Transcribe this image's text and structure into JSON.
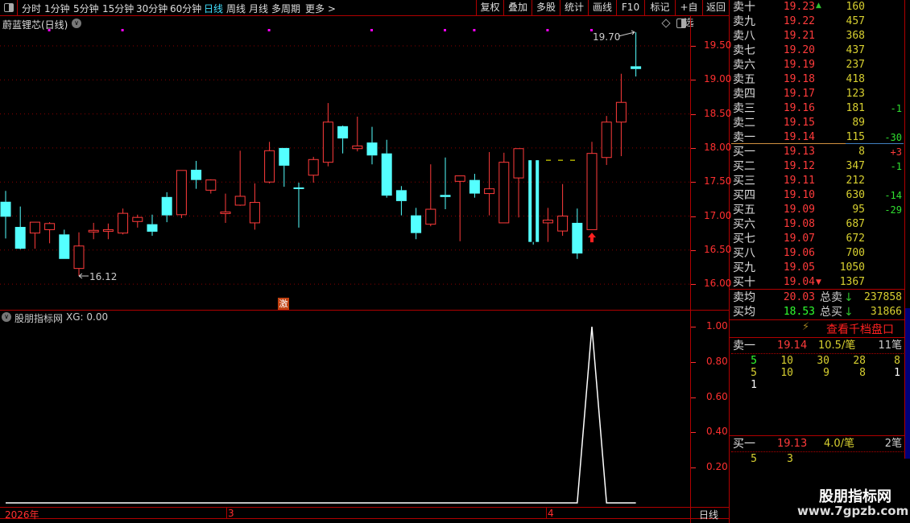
{
  "toolbar": {
    "periods": [
      "分时",
      "1分钟",
      "5分钟",
      "15分钟",
      "30分钟",
      "60分钟",
      "日线",
      "周线",
      "月线",
      "多周期",
      "更多 >"
    ],
    "active": "日线",
    "buttons": [
      "复权",
      "叠加",
      "多股",
      "统计",
      "画线",
      "F10",
      "标记",
      "+自选",
      "返回"
    ]
  },
  "chart": {
    "title": "蔚蓝锂芯(日线)",
    "high_label": "19.70",
    "low_label": "16.12",
    "signal_badge": "激",
    "price_ticks": [
      "19.50",
      "19.00",
      "18.50",
      "18.00",
      "17.50",
      "17.00",
      "16.50",
      "16.00"
    ]
  },
  "indicator": {
    "title": "股朋指标网",
    "value": "XG: 0.00",
    "ticks": [
      "1.00",
      "0.80",
      "0.60",
      "0.40",
      "0.20"
    ]
  },
  "time_axis": {
    "labels": [
      "2026年",
      "3",
      "4"
    ],
    "period": "日线"
  },
  "chart_data": {
    "type": "candlestick",
    "price_range": [
      15.9,
      19.8
    ],
    "candles": [
      [
        17.21,
        17.37,
        16.67,
        16.99
      ],
      [
        16.84,
        17.14,
        16.51,
        16.52
      ],
      [
        16.75,
        16.91,
        16.52,
        16.91
      ],
      [
        16.8,
        16.91,
        16.6,
        16.89
      ],
      [
        16.73,
        16.8,
        16.37,
        16.37
      ],
      [
        16.23,
        16.76,
        16.12,
        16.56
      ],
      [
        16.79,
        16.9,
        16.66,
        16.79
      ],
      [
        16.78,
        16.89,
        16.66,
        16.8
      ],
      [
        16.75,
        17.11,
        16.73,
        17.04
      ],
      [
        16.92,
        17.02,
        16.83,
        16.98
      ],
      [
        16.88,
        17.02,
        16.71,
        16.77
      ],
      [
        17.28,
        17.35,
        16.91,
        17.01
      ],
      [
        17.02,
        17.67,
        16.97,
        17.67
      ],
      [
        17.68,
        17.81,
        17.4,
        17.53
      ],
      [
        17.38,
        17.54,
        17.33,
        17.53
      ],
      [
        17.04,
        17.33,
        16.9,
        17.06
      ],
      [
        17.16,
        17.96,
        17.15,
        17.29
      ],
      [
        16.9,
        17.48,
        16.8,
        17.2
      ],
      [
        17.5,
        18.09,
        17.48,
        17.96
      ],
      [
        18.0,
        18.0,
        17.43,
        17.74
      ],
      [
        17.42,
        17.49,
        16.83,
        17.4
      ],
      [
        17.6,
        17.87,
        17.49,
        17.83
      ],
      [
        17.79,
        18.66,
        17.73,
        18.38
      ],
      [
        18.32,
        18.33,
        17.92,
        18.14
      ],
      [
        17.99,
        18.46,
        17.95,
        18.03
      ],
      [
        18.08,
        18.31,
        17.76,
        17.89
      ],
      [
        17.92,
        18.12,
        17.27,
        17.3
      ],
      [
        17.38,
        17.44,
        17.01,
        17.22
      ],
      [
        17.01,
        17.12,
        16.66,
        16.75
      ],
      [
        16.88,
        17.76,
        16.85,
        17.1
      ],
      [
        17.31,
        17.86,
        17.1,
        17.28
      ],
      [
        17.51,
        17.59,
        16.63,
        17.59
      ],
      [
        17.53,
        17.62,
        17.27,
        17.33
      ],
      [
        17.33,
        17.94,
        17.01,
        17.4
      ],
      [
        16.9,
        17.93,
        16.9,
        17.79
      ],
      [
        17.56,
        17.99,
        16.98,
        17.99
      ],
      [
        17.82,
        17.82,
        16.58,
        16.62
      ],
      [
        16.9,
        17.12,
        16.62,
        16.94
      ],
      [
        16.78,
        17.47,
        16.71,
        17.0
      ],
      [
        16.9,
        17.11,
        16.37,
        16.45
      ],
      [
        16.8,
        18.09,
        16.8,
        17.92
      ],
      [
        17.86,
        18.47,
        17.75,
        18.38
      ],
      [
        18.38,
        19.09,
        17.88,
        18.67
      ],
      [
        19.2,
        19.7,
        19.05,
        19.16
      ]
    ],
    "signal_dots": [
      3,
      8,
      18,
      25,
      30,
      32,
      37,
      40
    ],
    "dashed_level": 17.82,
    "arrow_index": 40,
    "indicator_values": [
      0,
      0,
      0,
      0,
      0,
      0,
      0,
      0,
      0,
      0,
      0,
      0,
      0,
      0,
      0,
      0,
      0,
      0,
      0,
      0,
      0,
      0,
      0,
      0,
      0,
      0,
      0,
      0,
      0,
      0,
      0,
      0,
      0,
      0,
      0,
      0,
      0,
      0,
      0,
      0,
      1,
      0,
      0,
      0
    ]
  },
  "orderbook": {
    "asks": [
      {
        "name": "卖十",
        "price": "19.23",
        "vol": "160",
        "chg": ""
      },
      {
        "name": "卖九",
        "price": "19.22",
        "vol": "457",
        "chg": ""
      },
      {
        "name": "卖八",
        "price": "19.21",
        "vol": "368",
        "chg": ""
      },
      {
        "name": "卖七",
        "price": "19.20",
        "vol": "437",
        "chg": ""
      },
      {
        "name": "卖六",
        "price": "19.19",
        "vol": "237",
        "chg": ""
      },
      {
        "name": "卖五",
        "price": "19.18",
        "vol": "418",
        "chg": ""
      },
      {
        "name": "卖四",
        "price": "19.17",
        "vol": "123",
        "chg": ""
      },
      {
        "name": "卖三",
        "price": "19.16",
        "vol": "181",
        "chg": "-1"
      },
      {
        "name": "卖二",
        "price": "19.15",
        "vol": "89",
        "chg": ""
      },
      {
        "name": "卖一",
        "price": "19.14",
        "vol": "115",
        "chg": "-30"
      }
    ],
    "bids": [
      {
        "name": "买一",
        "price": "19.13",
        "vol": "8",
        "chg": "+3"
      },
      {
        "name": "买二",
        "price": "19.12",
        "vol": "347",
        "chg": "-1"
      },
      {
        "name": "买三",
        "price": "19.11",
        "vol": "212",
        "chg": ""
      },
      {
        "name": "买四",
        "price": "19.10",
        "vol": "630",
        "chg": "-14"
      },
      {
        "name": "买五",
        "price": "19.09",
        "vol": "95",
        "chg": "-29"
      },
      {
        "name": "买六",
        "price": "19.08",
        "vol": "687",
        "chg": ""
      },
      {
        "name": "买七",
        "price": "19.07",
        "vol": "672",
        "chg": ""
      },
      {
        "name": "买八",
        "price": "19.06",
        "vol": "700",
        "chg": ""
      },
      {
        "name": "买九",
        "price": "19.05",
        "vol": "1050",
        "chg": ""
      },
      {
        "name": "买十",
        "price": "19.04",
        "vol": "1367",
        "chg": ""
      }
    ],
    "avg_sell": {
      "label": "卖均",
      "price": "20.03",
      "total_label": "总卖",
      "total": "237858"
    },
    "avg_buy": {
      "label": "买均",
      "price": "18.53",
      "total_label": "总买",
      "total": "31866"
    },
    "depth_link": "查看千档盘口",
    "sell1": {
      "label": "卖一",
      "price": "19.14",
      "avg": "10.5/笔",
      "count": "11笔",
      "rows": [
        [
          "5",
          "10",
          "30",
          "28",
          "8"
        ],
        [
          "5",
          "10",
          "9",
          "8",
          "1"
        ],
        [
          "1"
        ]
      ]
    },
    "buy1": {
      "label": "买一",
      "price": "19.13",
      "avg": "4.0/笔",
      "count": "2笔",
      "rows": [
        [
          "5",
          "3"
        ]
      ]
    }
  },
  "watermark": {
    "title": "股朋指标网",
    "url": "www.7gpzb.com"
  },
  "colors": {
    "up": "#ff3b3b",
    "down": "#54ffff",
    "grid": "#8a0000",
    "border": "#b00000"
  }
}
